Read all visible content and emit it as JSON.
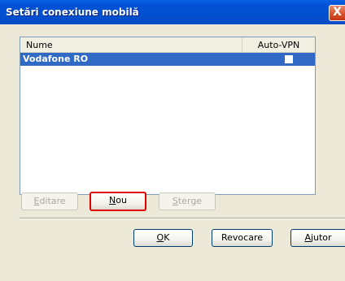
{
  "window": {
    "title": "Setări conexiune mobilă",
    "close_glyph": "X"
  },
  "list": {
    "columns": [
      "Nume",
      "Auto-VPN"
    ],
    "rows": [
      {
        "name": "Vodafone RO",
        "auto_vpn": false,
        "selected": true
      }
    ]
  },
  "actions": {
    "edit": {
      "label": "Editare",
      "mnemonic": "E",
      "rest": "ditare",
      "enabled": false
    },
    "new": {
      "label": "Nou",
      "mnemonic": "N",
      "rest": "ou",
      "enabled": true
    },
    "delete": {
      "label": "Sterge",
      "mnemonic": "S",
      "rest": "terge",
      "enabled": false
    }
  },
  "dialog_buttons": {
    "ok": {
      "label": "OK",
      "mnemonic": "O",
      "rest": "K"
    },
    "cancel": {
      "label": "Revocare"
    },
    "help": {
      "label": "Ajutor",
      "mnemonic": "A",
      "rest": "jutor"
    }
  },
  "colors": {
    "title_bar": "#0050D0",
    "selection": "#316AC5",
    "focus_border": "#E00000",
    "dialog_bg": "#ECE9D8"
  }
}
